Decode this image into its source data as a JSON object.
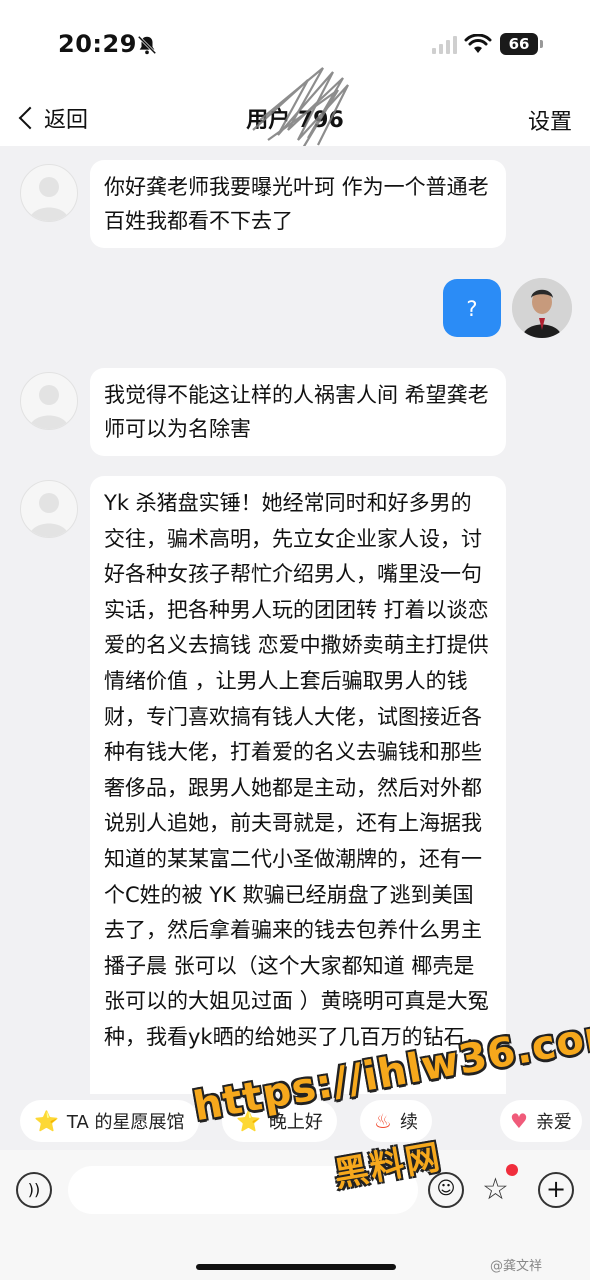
{
  "status": {
    "time": "20:29",
    "battery": "66"
  },
  "nav": {
    "back_label": "返回",
    "title": "用户 796",
    "settings_label": "设置"
  },
  "messages": [
    {
      "from": "other",
      "text": "你好龚老师我要曝光叶珂 作为一个普通老百姓我都看不下去了"
    },
    {
      "from": "me",
      "text": "?"
    },
    {
      "from": "other",
      "text": "我觉得不能这让样的人祸害人间 希望龚老师可以为名除害"
    },
    {
      "from": "other",
      "text": "Yk 杀猪盘实锤！她经常同时和好多男的交往，骗术高明，先立女企业家人设，讨好各种女孩子帮忙介绍男人，嘴里没一句实话，把各种男人玩的团团转 打着以谈恋爱的名义去搞钱 恋爱中撒娇卖萌主打提供情绪价值 ，让男人上套后骗取男人的钱财，专门喜欢搞有钱人大佬，试图接近各种有钱大佬，打着爱的名义去骗钱和那些奢侈品，跟男人她都是主动，然后对外都说别人追她，前夫哥就是，还有上海据我知道的某某富二代小圣做潮牌的，还有一个C姓的被 YK 欺骗已经崩盘了逃到美国去了，然后拿着骗来的钱去包养什么男主播子晨 张可以（这个大家都知道 椰壳是张可以的大姐见过面 ）黄晓明可真是大冤种，我看yk晒的给她买了几百万的钻石，"
    }
  ],
  "chips": [
    {
      "icon": "star-face",
      "label": "TA 的星愿展馆"
    },
    {
      "icon": "star-face",
      "label": "晚上好"
    },
    {
      "icon": "fire",
      "label": "续"
    },
    {
      "icon": "heart",
      "label": "亲爱"
    }
  ],
  "watermark": {
    "url": "https://ihlw36.com",
    "name": "黑料网"
  },
  "weibo_mark": "@龚文祥",
  "colors": {
    "my_bubble": "#2b8cf6",
    "chat_bg": "#f1f1f3",
    "watermark": "#f6a81c"
  }
}
